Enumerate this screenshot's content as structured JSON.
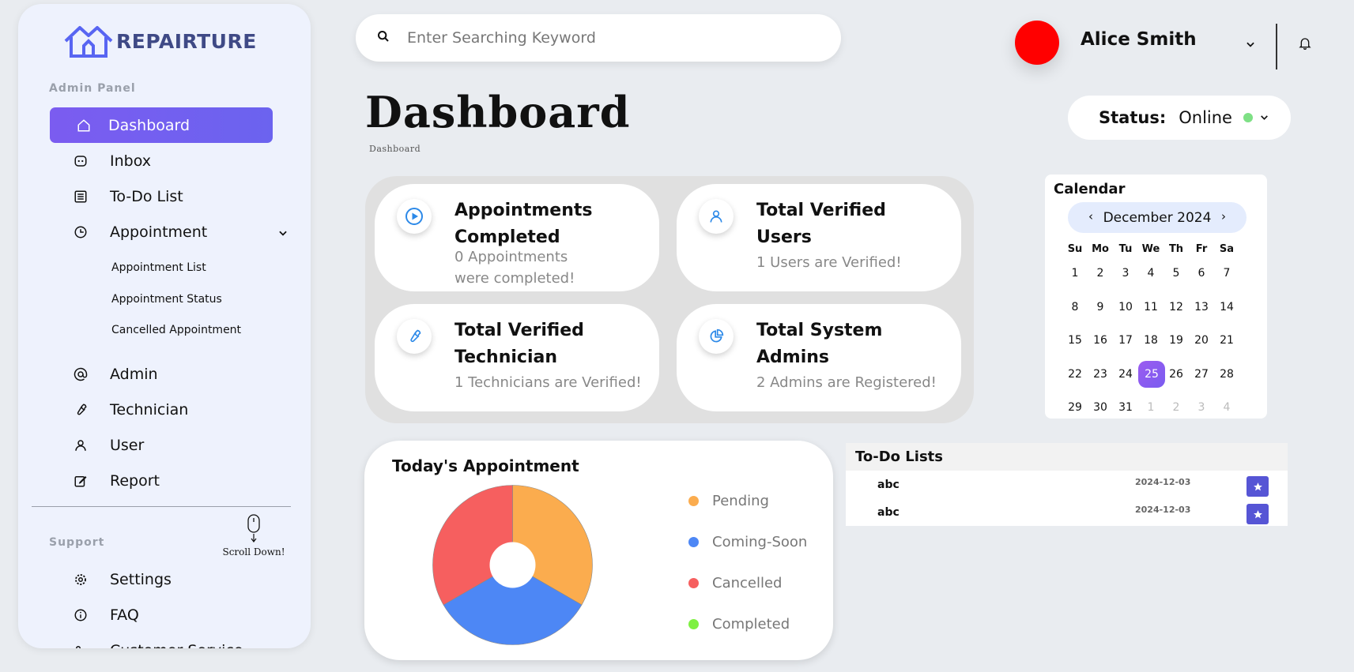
{
  "brand": {
    "name": "REPAIRTURE",
    "color": "#3f4a86",
    "accent": "#5865f2"
  },
  "sidebar": {
    "admin_label": "Admin Panel",
    "items": [
      {
        "label": "Dashboard",
        "icon": "home-icon",
        "active": true
      },
      {
        "label": "Inbox",
        "icon": "inbox-icon"
      },
      {
        "label": "To-Do List",
        "icon": "list-icon"
      },
      {
        "label": "Appointment",
        "icon": "clock-icon",
        "expandable": true
      },
      {
        "label": "Admin",
        "icon": "at-icon"
      },
      {
        "label": "Technician",
        "icon": "wrench-icon"
      },
      {
        "label": "User",
        "icon": "user-icon"
      },
      {
        "label": "Report",
        "icon": "edit-icon"
      }
    ],
    "appointment_sub": [
      "Appointment List",
      "Appointment Status",
      "Cancelled Appointment"
    ],
    "support_label": "Support",
    "scroll_hint": "Scroll Down!",
    "support_items": [
      {
        "label": "Settings",
        "icon": "gear-icon"
      },
      {
        "label": "FAQ",
        "icon": "info-icon"
      },
      {
        "label": "Customer Service",
        "icon": "headset-icon",
        "expandable": true
      }
    ]
  },
  "search": {
    "placeholder": "Enter Searching Keyword"
  },
  "user": {
    "name": "Alice Smith",
    "avatar_color": "#ff0000"
  },
  "page": {
    "title": "Dashboard",
    "breadcrumb": "Dashboard"
  },
  "status": {
    "label": "Status:",
    "value": "Online",
    "dot_color": "#7ee085"
  },
  "stats": [
    {
      "title": "Appointments Completed",
      "subtitle": "0 Appointments were completed!",
      "icon": "play-icon"
    },
    {
      "title": "Total Verified Users",
      "subtitle": "1 Users are Verified!",
      "icon": "user-icon"
    },
    {
      "title": "Total Verified Technician",
      "subtitle": "1 Technicians are Verified!",
      "icon": "wrench-icon"
    },
    {
      "title": "Total System Admins",
      "subtitle": "2 Admins are Registered!",
      "icon": "pie-chart-icon"
    }
  ],
  "calendar": {
    "title": "Calendar",
    "month": "December 2024",
    "weekdays": [
      "Su",
      "Mo",
      "Tu",
      "We",
      "Th",
      "Fr",
      "Sa"
    ],
    "weeks": [
      [
        "1",
        "2",
        "3",
        "4",
        "5",
        "6",
        "7"
      ],
      [
        "8",
        "9",
        "10",
        "11",
        "12",
        "13",
        "14"
      ],
      [
        "15",
        "16",
        "17",
        "18",
        "19",
        "20",
        "21"
      ],
      [
        "22",
        "23",
        "24",
        "25",
        "26",
        "27",
        "28"
      ],
      [
        "29",
        "30",
        "31",
        "1",
        "2",
        "3",
        "4"
      ]
    ],
    "selected": "25"
  },
  "chart_data": {
    "type": "pie",
    "title": "Today's Appointment",
    "categories": [
      "Pending",
      "Coming-Soon",
      "Cancelled",
      "Completed"
    ],
    "values": [
      1,
      1,
      1,
      0
    ],
    "colors": [
      "#fbac4e",
      "#4d87f5",
      "#f65f5f",
      "#7ef041"
    ]
  },
  "todo": {
    "title": "To-Do Lists",
    "items": [
      {
        "name": "abc",
        "date": "2024-12-03"
      },
      {
        "name": "abc",
        "date": "2024-12-03"
      }
    ]
  }
}
